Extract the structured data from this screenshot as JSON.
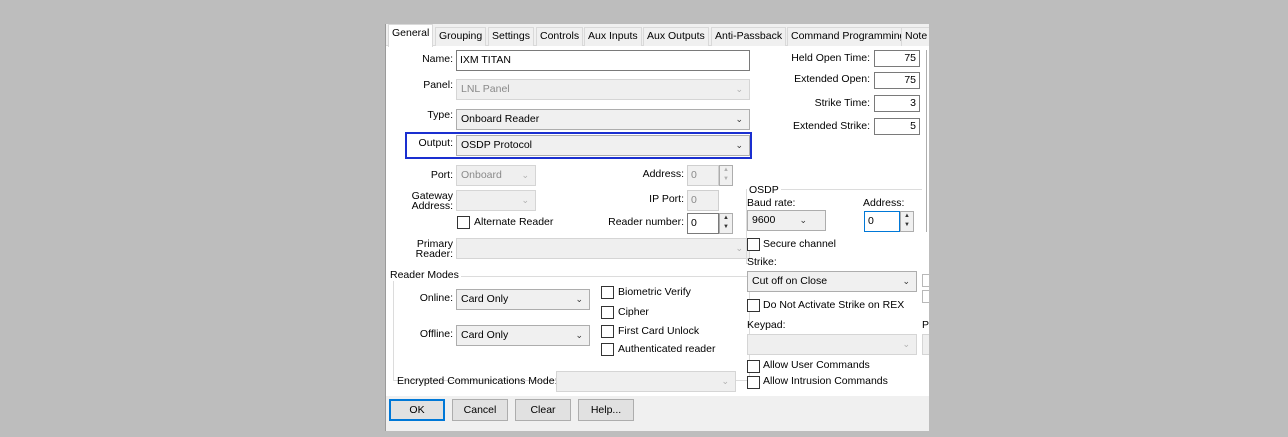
{
  "tabs": [
    "General",
    "Grouping",
    "Settings",
    "Controls",
    "Aux Inputs",
    "Aux Outputs",
    "Anti-Passback",
    "Command Programming",
    "Note"
  ],
  "general": {
    "name_label": "Name:",
    "name_value": "IXM TITAN",
    "panel_label": "Panel:",
    "panel_value": "LNL Panel",
    "type_label": "Type:",
    "type_value": "Onboard Reader",
    "output_label": "Output:",
    "output_value": "OSDP Protocol",
    "port_label": "Port:",
    "port_value": "Onboard",
    "address_label": "Address:",
    "address_value": "0",
    "gateway_label_1": "Gateway",
    "gateway_label_2": "Address:",
    "ip_port_label": "IP Port:",
    "ip_port_value": "0",
    "alternate_reader_label": "Alternate Reader",
    "reader_number_label": "Reader number:",
    "reader_number_value": "0",
    "primary_reader_label_1": "Primary",
    "primary_reader_label_2": "Reader:"
  },
  "timing": {
    "held_open_label": "Held Open Time:",
    "held_open_value": "75",
    "extended_open_label": "Extended Open:",
    "extended_open_value": "75",
    "strike_time_label": "Strike Time:",
    "strike_time_value": "3",
    "extended_strike_label": "Extended Strike:",
    "extended_strike_value": "5"
  },
  "osdp": {
    "group_title": "OSDP",
    "baud_label": "Baud rate:",
    "baud_value": "9600",
    "address_label": "Address:",
    "address_value": "0",
    "secure_channel_label": "Secure channel"
  },
  "strike": {
    "label": "Strike:",
    "value": "Cut off on Close",
    "no_strike_rex_label": "Do Not Activate Strike on REX",
    "keypad_label": "Keypad:",
    "keypad_value": "",
    "allow_user_cmds_label": "Allow User Commands",
    "allow_intrusion_cmds_label": "Allow Intrusion Commands",
    "clipped_p": "P"
  },
  "reader_modes": {
    "title": "Reader Modes",
    "online_label": "Online:",
    "online_value": "Card Only",
    "offline_label": "Offline:",
    "offline_value": "Card Only",
    "biometric_verify_label": "Biometric Verify",
    "cipher_label": "Cipher",
    "first_card_unlock_label": "First Card Unlock",
    "authenticated_reader_label": "Authenticated reader"
  },
  "encrypted": {
    "label": "Encrypted Communications Mode:",
    "value": ""
  },
  "buttons": {
    "ok": "OK",
    "cancel": "Cancel",
    "clear": "Clear",
    "help": "Help..."
  },
  "colors": {
    "highlight": "#1a2fd0",
    "background": "#bdbdbd"
  }
}
